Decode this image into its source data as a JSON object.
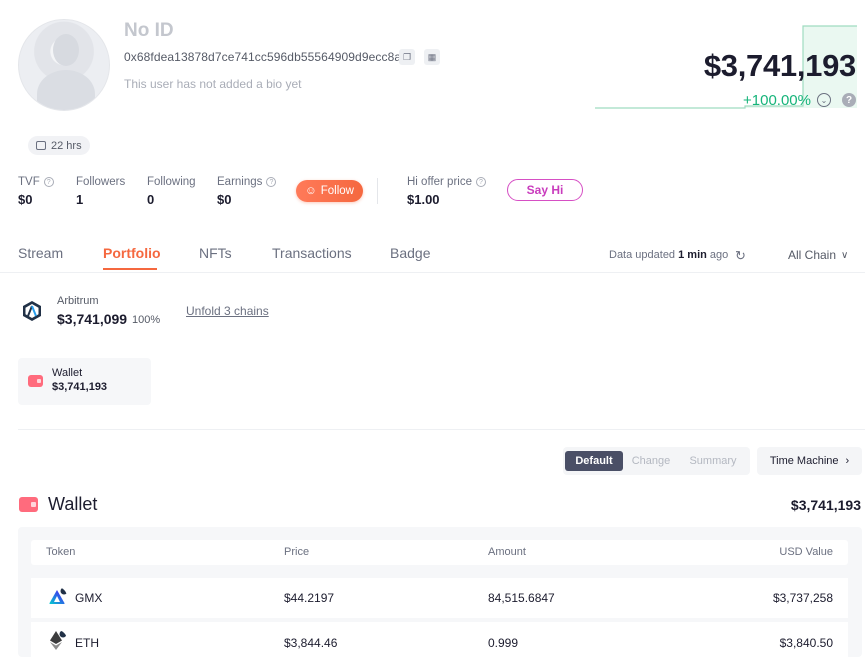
{
  "profile": {
    "name": "No ID",
    "address": "0x68fdea13878d7ce741cc596db55564909d9ecc8a",
    "bio": "This user has not added a bio yet",
    "active_time": "22 hrs"
  },
  "net_worth": {
    "total": "$3,741,193",
    "change": "+100.00%",
    "accent_color": "#16b47a"
  },
  "stats": {
    "tvf": {
      "label": "TVF",
      "value": "$0"
    },
    "followers": {
      "label": "Followers",
      "value": "1"
    },
    "following": {
      "label": "Following",
      "value": "0"
    },
    "earnings": {
      "label": "Earnings",
      "value": "$0"
    },
    "follow_label": "Follow",
    "hi_offer": {
      "label": "Hi offer price",
      "value": "$1.00"
    },
    "say_hi_label": "Say Hi"
  },
  "tabs": [
    {
      "label": "Stream"
    },
    {
      "label": "Portfolio",
      "active": true
    },
    {
      "label": "NFTs"
    },
    {
      "label": "Transactions"
    },
    {
      "label": "Badge"
    }
  ],
  "data_status": {
    "prefix": "Data updated",
    "time": "1 min",
    "suffix": "ago",
    "chain_filter": "All Chain"
  },
  "chain": {
    "name": "Arbitrum",
    "value": "$3,741,099",
    "percent": "100%",
    "unfold_label": "Unfold 3 chains"
  },
  "wallet_card": {
    "title": "Wallet",
    "value": "$3,741,193"
  },
  "view_modes": {
    "default": "Default",
    "change": "Change",
    "summary": "Summary",
    "time_machine": "Time Machine"
  },
  "wallet_section": {
    "title": "Wallet",
    "total": "$3,741,193",
    "columns": [
      "Token",
      "Price",
      "Amount",
      "USD Value"
    ],
    "rows": [
      {
        "token": "GMX",
        "price": "$44.2197",
        "amount": "84,515.6847",
        "usd_value": "$3,737,258"
      },
      {
        "token": "ETH",
        "price": "$3,844.46",
        "amount": "0.999",
        "usd_value": "$3,840.50"
      }
    ]
  }
}
